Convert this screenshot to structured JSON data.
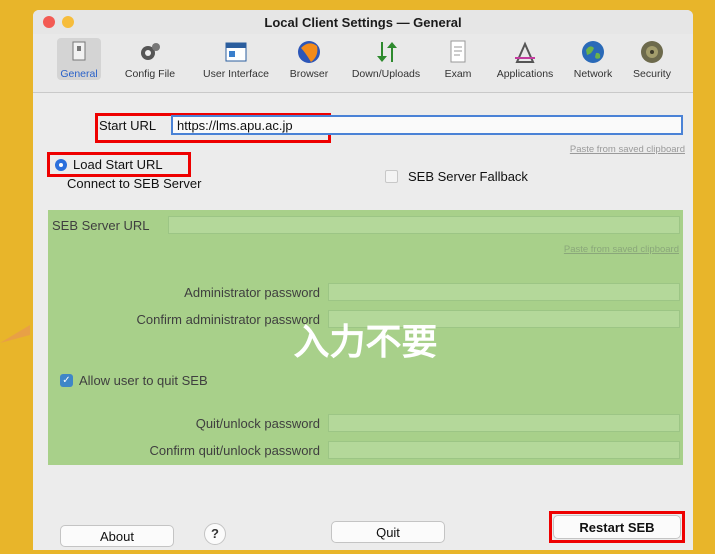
{
  "window": {
    "title": "Local Client Settings — General"
  },
  "toolbar": {
    "items": [
      {
        "label": "General",
        "icon": "general-icon"
      },
      {
        "label": "Config File",
        "icon": "config-file-icon"
      },
      {
        "label": "User Interface",
        "icon": "user-interface-icon"
      },
      {
        "label": "Browser",
        "icon": "browser-icon"
      },
      {
        "label": "Down/Uploads",
        "icon": "down-uploads-icon"
      },
      {
        "label": "Exam",
        "icon": "exam-icon"
      },
      {
        "label": "Applications",
        "icon": "applications-icon"
      },
      {
        "label": "Network",
        "icon": "network-icon"
      },
      {
        "label": "Security",
        "icon": "security-icon"
      }
    ]
  },
  "general": {
    "start_url_label": "Start URL",
    "start_url_value": "https://lms.apu.ac.jp",
    "paste_link": "Paste from saved clipboard",
    "load_start_url": "Load Start URL",
    "connect_seb_server": "Connect to SEB Server",
    "seb_server_fallback": "SEB Server Fallback"
  },
  "server_section": {
    "seb_server_url_label": "SEB Server URL",
    "paste_link": "Paste from saved clipboard",
    "admin_password_label": "Administrator password",
    "confirm_admin_password_label": "Confirm administrator password",
    "overlay_note": "入力不要",
    "allow_quit_label": "Allow user to quit SEB",
    "quit_password_label": "Quit/unlock password",
    "confirm_quit_password_label": "Confirm quit/unlock password"
  },
  "footer": {
    "about": "About",
    "help": "?",
    "quit": "Quit",
    "restart": "Restart SEB"
  },
  "colors": {
    "highlight_box": "#ee0000",
    "overlay_green": "#a8d08a",
    "accent_blue": "#2b6fdc",
    "background_frame": "#e8b52a"
  }
}
